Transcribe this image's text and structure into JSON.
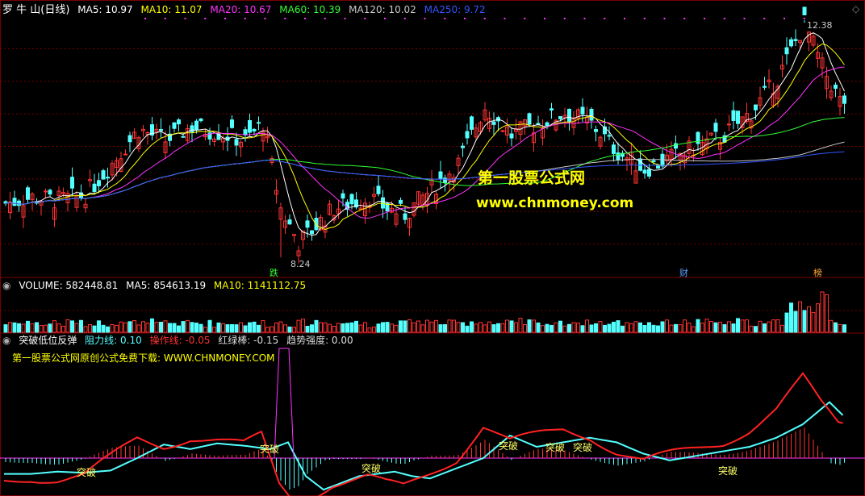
{
  "colors": {
    "up": "#ff3333",
    "down": "#54ffff",
    "ma5": "#ffffff",
    "ma10": "#ffff00",
    "ma20": "#ff33ff",
    "ma60": "#33ff33",
    "ma120": "#c8c8c8",
    "ma250": "#3355ff",
    "grid": "#7a0000"
  },
  "main": {
    "stock_title": "罗 牛 山(日线)",
    "ma5": "MA5: 10.97",
    "ma10": "MA10: 11.07",
    "ma20": "MA20: 10.67",
    "ma60": "MA60: 10.39",
    "ma120": "MA120: 10.02",
    "ma250": "MA250: 9.72",
    "high_label": "12.38",
    "low_label": "8.24",
    "markers": [
      "跌",
      "财",
      "榜"
    ]
  },
  "volume": {
    "label": "VOLUME: 582448.81",
    "ma5": "MA5: 854613.19",
    "ma10": "MA10: 1141112.75"
  },
  "indicator": {
    "name": "突破低位反弹",
    "resist": "阻力线: 0.10",
    "operate": "操作线: -0.05",
    "redgreen": "红绿棒: -0.15",
    "trend": "趋势强度: 0.00",
    "note": "第一股票公式网原创公式免费下载: WWW.CHNMONEY.COM",
    "signal_text": "突破"
  },
  "watermark": {
    "cn": "第一股票公式网",
    "url": "www.chnmoney.com"
  },
  "chart_data": {
    "type": "candlestick",
    "price_range": [
      7.9,
      12.5
    ],
    "high": 12.38,
    "low": 8.24,
    "price_close_trend": [
      [
        0,
        9.2
      ],
      [
        6,
        9.3
      ],
      [
        12,
        9.25
      ],
      [
        18,
        9.35
      ],
      [
        24,
        9.9
      ],
      [
        30,
        10.5
      ],
      [
        36,
        10.3
      ],
      [
        42,
        10.55
      ],
      [
        48,
        10.45
      ],
      [
        54,
        10.3
      ],
      [
        58,
        10.6
      ],
      [
        62,
        9.1
      ],
      [
        66,
        8.5
      ],
      [
        70,
        8.8
      ],
      [
        74,
        9.1
      ],
      [
        78,
        9.2
      ],
      [
        82,
        9.3
      ],
      [
        86,
        9.1
      ],
      [
        90,
        9.0
      ],
      [
        94,
        9.3
      ],
      [
        98,
        9.6
      ],
      [
        102,
        9.9
      ],
      [
        108,
        10.9
      ],
      [
        114,
        10.4
      ],
      [
        120,
        10.6
      ],
      [
        126,
        10.8
      ],
      [
        132,
        10.6
      ],
      [
        138,
        10.1
      ],
      [
        144,
        9.8
      ],
      [
        150,
        10.0
      ],
      [
        156,
        10.2
      ],
      [
        162,
        10.4
      ],
      [
        168,
        10.8
      ],
      [
        174,
        11.4
      ],
      [
        180,
        12.38
      ],
      [
        184,
        11.6
      ],
      [
        188,
        11.0
      ]
    ],
    "volume_range": [
      0,
      2500000
    ],
    "indicator_signals": [
      "突破",
      "突破",
      "突破",
      "突破",
      "突破",
      "突破",
      "突破"
    ]
  }
}
